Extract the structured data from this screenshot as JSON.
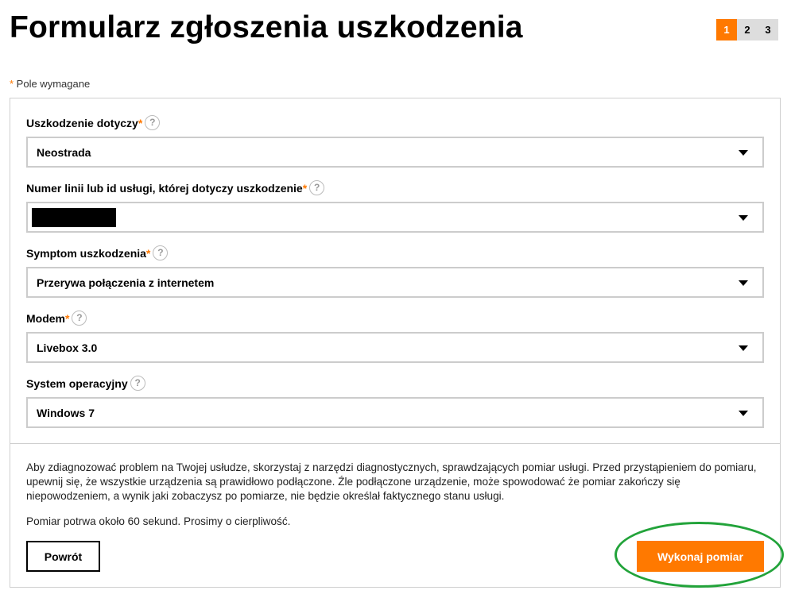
{
  "title": "Formularz zgłoszenia uszkodzenia",
  "steps": [
    "1",
    "2",
    "3"
  ],
  "required_note": {
    "star": "*",
    "text": " Pole wymagane"
  },
  "help_glyph": "?",
  "fields": [
    {
      "label": "Uszkodzenie dotyczy",
      "required": "*",
      "value": "Neostrada"
    },
    {
      "label": "Numer linii lub id usługi, której dotyczy uszkodzenie",
      "required": "*",
      "value": ""
    },
    {
      "label": "Symptom uszkodzenia",
      "required": "*",
      "value": "Przerywa połączenia z internetem"
    },
    {
      "label": "Modem",
      "required": "*",
      "value": "Livebox 3.0"
    },
    {
      "label": "System operacyjny",
      "required": "",
      "value": "Windows 7"
    }
  ],
  "info_text": "Aby zdiagnozować problem na Twojej usłudze, skorzystaj z narzędzi diagnostycznych, sprawdzających pomiar usługi. Przed przystąpieniem do pomiaru, upewnij się, że wszystkie urządzenia są prawidłowo podłączone. Źle podłączone urządzenie, może spowodować że pomiar zakończy się niepowodzeniem, a wynik jaki zobaczysz po pomiarze, nie będzie określał faktycznego stanu usługi.",
  "wait_text": "Pomiar potrwa około 60 sekund. Prosimy o cierpliwość.",
  "buttons": {
    "back": "Powrót",
    "measure": "Wykonaj pomiar"
  },
  "colors": {
    "accent": "#ff7900",
    "highlight": "#22a33a",
    "border": "#cccccc"
  },
  "icons": {
    "help": "question-circle-icon",
    "dropdown": "caret-down-icon"
  }
}
